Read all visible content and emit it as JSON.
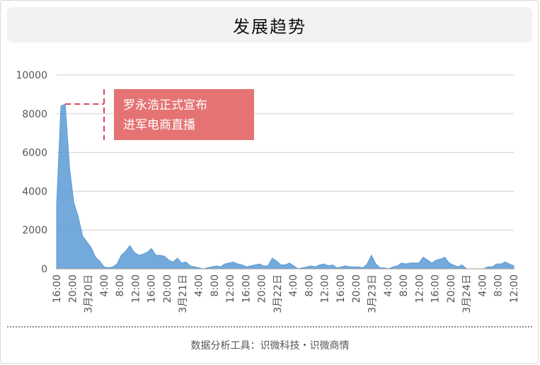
{
  "header": {
    "title": "发展趋势"
  },
  "footer": {
    "source": "数据分析工具：识微科技・识微商情"
  },
  "colors": {
    "area": "#5b9bd5",
    "annotation_bg": "#e57373",
    "annotation_line": "#d9485a",
    "grid": "#d0d0d0"
  },
  "chart_data": {
    "type": "area",
    "title": "",
    "xlabel": "",
    "ylabel": "",
    "ylim": [
      0,
      10000
    ],
    "yticks": [
      0,
      2000,
      4000,
      6000,
      8000,
      10000
    ],
    "grid": true,
    "legend": "none",
    "x_tick_labels": [
      "16:00",
      "20:00",
      "3月20日",
      "4:00",
      "8:00",
      "12:00",
      "16:00",
      "20:00",
      "3月21日",
      "4:00",
      "8:00",
      "12:00",
      "16:00",
      "20:00",
      "3月22日",
      "4:00",
      "8:00",
      "12:00",
      "16:00",
      "20:00",
      "3月23日",
      "4:00",
      "8:00",
      "12:00",
      "16:00",
      "20:00",
      "3月24日",
      "4:00",
      "8:00",
      "12:00"
    ],
    "series": [
      {
        "values": [
          3300,
          8400,
          8500,
          5200,
          3400,
          2700,
          1700,
          1400,
          1100,
          600,
          400,
          100,
          50,
          100,
          250,
          700,
          900,
          1200,
          850,
          700,
          750,
          850,
          1050,
          700,
          700,
          650,
          450,
          350,
          550,
          300,
          350,
          150,
          100,
          50,
          0,
          50,
          100,
          150,
          100,
          250,
          300,
          350,
          250,
          200,
          100,
          150,
          200,
          250,
          150,
          150,
          550,
          400,
          200,
          200,
          300,
          150,
          0,
          50,
          100,
          150,
          100,
          200,
          250,
          150,
          200,
          50,
          100,
          150,
          100,
          100,
          100,
          50,
          250,
          700,
          250,
          50,
          50,
          0,
          100,
          150,
          300,
          250,
          300,
          300,
          300,
          600,
          450,
          300,
          450,
          500,
          600,
          300,
          200,
          100,
          200,
          0,
          0,
          0,
          0,
          0,
          100,
          100,
          250,
          250,
          350,
          250,
          150
        ]
      }
    ],
    "annotations": [
      {
        "text_line1": "罗永浩正式宣布",
        "text_line2": "进军电商直播",
        "x_index": 2,
        "y": 8500
      }
    ]
  }
}
